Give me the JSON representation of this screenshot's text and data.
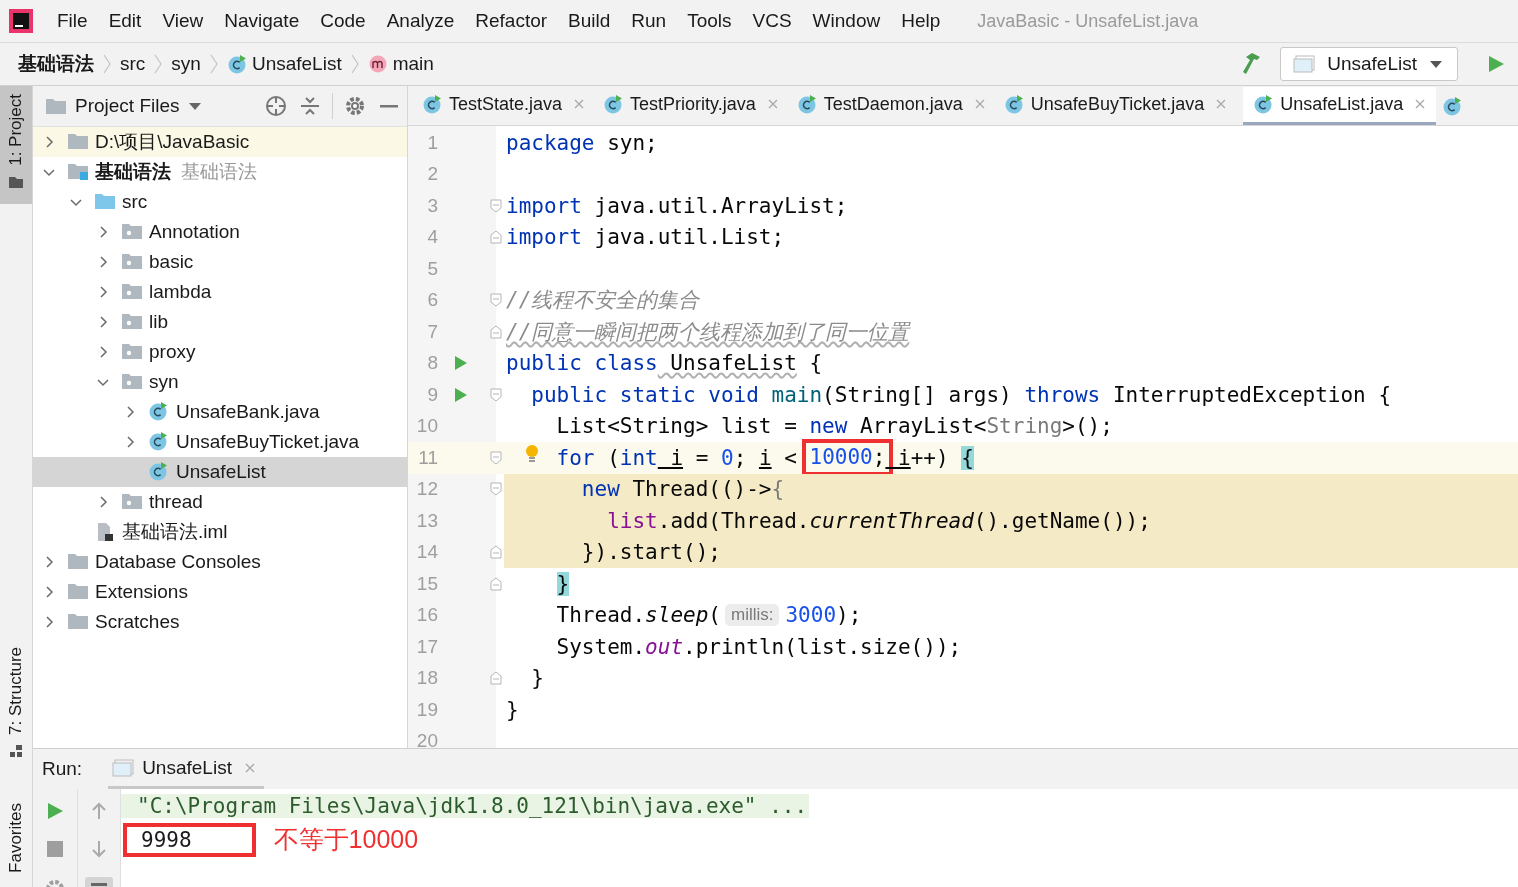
{
  "menu": [
    "File",
    "Edit",
    "View",
    "Navigate",
    "Code",
    "Analyze",
    "Refactor",
    "Build",
    "Run",
    "Tools",
    "VCS",
    "Window",
    "Help"
  ],
  "window_title": "JavaBasic - UnsafeList.java",
  "breadcrumbs": [
    {
      "label": "基础语法",
      "kind": "module"
    },
    {
      "label": "src",
      "kind": "folder"
    },
    {
      "label": "syn",
      "kind": "folder"
    },
    {
      "label": "UnsafeList",
      "kind": "class"
    },
    {
      "label": "main",
      "kind": "method"
    }
  ],
  "run_config": {
    "label": "UnsafeList"
  },
  "tool_strip": {
    "top": [
      {
        "label": "1: Project",
        "kind": "project",
        "selected": true
      }
    ],
    "bottom": [
      {
        "label": "7: Structure",
        "kind": "structure",
        "selected": false
      },
      {
        "label": "Favorites",
        "kind": "favorites",
        "selected": false
      }
    ]
  },
  "project_panel": {
    "title": "Project Files",
    "tree": [
      {
        "label": "D:\\项目\\JavaBasic",
        "kind": "folder",
        "expanded": false,
        "selected": false,
        "highlighted": true
      },
      {
        "label": "基础语法",
        "note": "基础语法",
        "kind": "module",
        "expanded": true,
        "selected": false,
        "children": [
          {
            "label": "src",
            "kind": "source",
            "expanded": true,
            "selected": false,
            "children": [
              {
                "label": "Annotation",
                "kind": "package",
                "expanded": false,
                "selected": false
              },
              {
                "label": "basic",
                "kind": "package",
                "expanded": false,
                "selected": false
              },
              {
                "label": "lambda",
                "kind": "package",
                "expanded": false,
                "selected": false
              },
              {
                "label": "lib",
                "kind": "package",
                "expanded": false,
                "selected": false
              },
              {
                "label": "proxy",
                "kind": "package",
                "expanded": false,
                "selected": false
              },
              {
                "label": "syn",
                "kind": "package",
                "expanded": true,
                "selected": false,
                "children": [
                  {
                    "label": "UnsafeBank.java",
                    "kind": "class",
                    "expanded": false,
                    "selected": false
                  },
                  {
                    "label": "UnsafeBuyTicket.java",
                    "kind": "class",
                    "expanded": false,
                    "selected": false
                  },
                  {
                    "label": "UnsafeList",
                    "kind": "class",
                    "selected": true
                  }
                ]
              },
              {
                "label": "thread",
                "kind": "package",
                "expanded": false,
                "selected": false
              }
            ]
          },
          {
            "label": "基础语法.iml",
            "kind": "file",
            "selected": false
          }
        ]
      },
      {
        "label": "Database Consoles",
        "kind": "folder",
        "expanded": false,
        "selected": false
      },
      {
        "label": "Extensions",
        "kind": "folder",
        "expanded": false,
        "selected": false
      },
      {
        "label": "Scratches",
        "kind": "folder",
        "expanded": false,
        "selected": false
      }
    ]
  },
  "editor": {
    "tabs": [
      {
        "label": "TestState.java",
        "selected": false
      },
      {
        "label": "TestPriority.java",
        "selected": false
      },
      {
        "label": "TestDaemon.java",
        "selected": false
      },
      {
        "label": "UnsafeBuyTicket.java",
        "selected": false
      },
      {
        "label": "UnsafeList.java",
        "selected": true
      }
    ],
    "lines": [
      {
        "number": "1",
        "tokens": [
          {
            "kind": "kw",
            "text": "package"
          },
          {
            "kind": "txt",
            "text": " syn;"
          }
        ]
      },
      {
        "number": "2"
      },
      {
        "number": "3",
        "fold_start": true,
        "tokens": [
          {
            "kind": "kw",
            "text": "import"
          },
          {
            "kind": "txt",
            "text": " java.util.ArrayList;"
          }
        ]
      },
      {
        "number": "4",
        "fold_end": true,
        "tokens": [
          {
            "kind": "kw",
            "text": "import"
          },
          {
            "kind": "txt",
            "text": " java.util.List;"
          }
        ]
      },
      {
        "number": "5"
      },
      {
        "number": "6",
        "fold_start": true,
        "tokens": [
          {
            "kind": "cmt",
            "text": "//线程不安全的集合"
          }
        ]
      },
      {
        "number": "7",
        "fold_end": true,
        "tokens": [
          {
            "kind": "cmt",
            "text": "//同意一瞬间把两个线程添加到了同一位置",
            "wavy": true
          }
        ]
      },
      {
        "number": "8",
        "run": true,
        "tokens": [
          {
            "kind": "kw",
            "text": "public class"
          },
          {
            "kind": "txt",
            "text": " UnsafeList",
            "wavy": true
          },
          {
            "kind": "txt",
            "text": " {"
          }
        ]
      },
      {
        "number": "9",
        "run": true,
        "fold_start": true,
        "tokens": [
          {
            "kind": "kw",
            "text": "  public static void"
          },
          {
            "kind": "decl",
            "text": " main"
          },
          {
            "kind": "txt",
            "text": "(String[] args) "
          },
          {
            "kind": "kw",
            "text": "throws"
          },
          {
            "kind": "txt",
            "text": " InterruptedException {"
          }
        ]
      },
      {
        "number": "10",
        "tokens": [
          {
            "kind": "txt",
            "text": "    List<String> list = "
          },
          {
            "kind": "kw",
            "text": "new"
          },
          {
            "kind": "txt",
            "text": " ArrayList<"
          },
          {
            "kind": "generic",
            "text": "String"
          },
          {
            "kind": "txt",
            "text": ">();"
          }
        ]
      },
      {
        "number": "11",
        "current": true,
        "fold_start": true,
        "bulb": true,
        "tokens": [
          {
            "kind": "kw",
            "text": "    for"
          },
          {
            "kind": "txt",
            "text": " ("
          },
          {
            "kind": "kw",
            "text": "int"
          },
          {
            "kind": "var",
            "text": " i"
          },
          {
            "kind": "txt",
            "text": " = "
          },
          {
            "kind": "num",
            "text": "0"
          },
          {
            "kind": "txt",
            "text": "; "
          },
          {
            "kind": "var",
            "text": "i"
          },
          {
            "kind": "txt",
            "text": " < "
          },
          {
            "kind": "num",
            "text": "10000",
            "annotated": true
          },
          {
            "kind": "txt",
            "text": ";",
            "annotated": true
          },
          {
            "kind": "var",
            "text": " i"
          },
          {
            "kind": "txt",
            "text": "++) "
          },
          {
            "kind": "brace",
            "text": "{"
          }
        ]
      },
      {
        "number": "12",
        "lambda": true,
        "fold_start": true,
        "tokens": [
          {
            "kind": "kw",
            "text": "      new"
          },
          {
            "kind": "txt",
            "text": " Thread(()->"
          },
          {
            "kind": "generic",
            "text": "{"
          }
        ]
      },
      {
        "number": "13",
        "lambda": true,
        "tokens": [
          {
            "kind": "field",
            "text": "        list"
          },
          {
            "kind": "txt",
            "text": ".add(Thread."
          },
          {
            "kind": "ital",
            "text": "currentThread"
          },
          {
            "kind": "txt",
            "text": "().getName());"
          }
        ]
      },
      {
        "number": "14",
        "lambda": true,
        "fold_end": true,
        "tokens": [
          {
            "kind": "txt",
            "text": "      })"
          },
          {
            "kind": "txt",
            "text": ".start();"
          }
        ]
      },
      {
        "number": "15",
        "fold_end": true,
        "tokens": [
          {
            "kind": "brace",
            "text": "    }"
          }
        ]
      },
      {
        "number": "16",
        "tokens": [
          {
            "kind": "txt",
            "text": "    Thread."
          },
          {
            "kind": "ital",
            "text": "sleep"
          },
          {
            "kind": "txt",
            "text": "("
          },
          {
            "kind": "hint",
            "text": "millis:"
          },
          {
            "kind": "num",
            "text": "3000"
          },
          {
            "kind": "txt",
            "text": ");"
          }
        ]
      },
      {
        "number": "17",
        "tokens": [
          {
            "kind": "txt",
            "text": "    System."
          },
          {
            "kind": "static",
            "text": "out"
          },
          {
            "kind": "txt",
            "text": ".println(list.size());"
          }
        ]
      },
      {
        "number": "18",
        "fold_end": true,
        "tokens": [
          {
            "kind": "txt",
            "text": "  }"
          }
        ]
      },
      {
        "number": "19",
        "tokens": [
          {
            "kind": "txt",
            "text": "}"
          }
        ]
      },
      {
        "number": "20"
      }
    ]
  },
  "run_panel": {
    "label": "Run:",
    "tabs": [
      {
        "label": "UnsafeList",
        "selected": true
      }
    ],
    "console": [
      {
        "text": "\"C:\\Program Files\\Java\\jdk1.8.0_121\\bin\\java.exe\" ...",
        "kind": "command"
      },
      {
        "text": "9998",
        "kind": "output",
        "annotated": true
      }
    ],
    "note": "不等于10000"
  }
}
